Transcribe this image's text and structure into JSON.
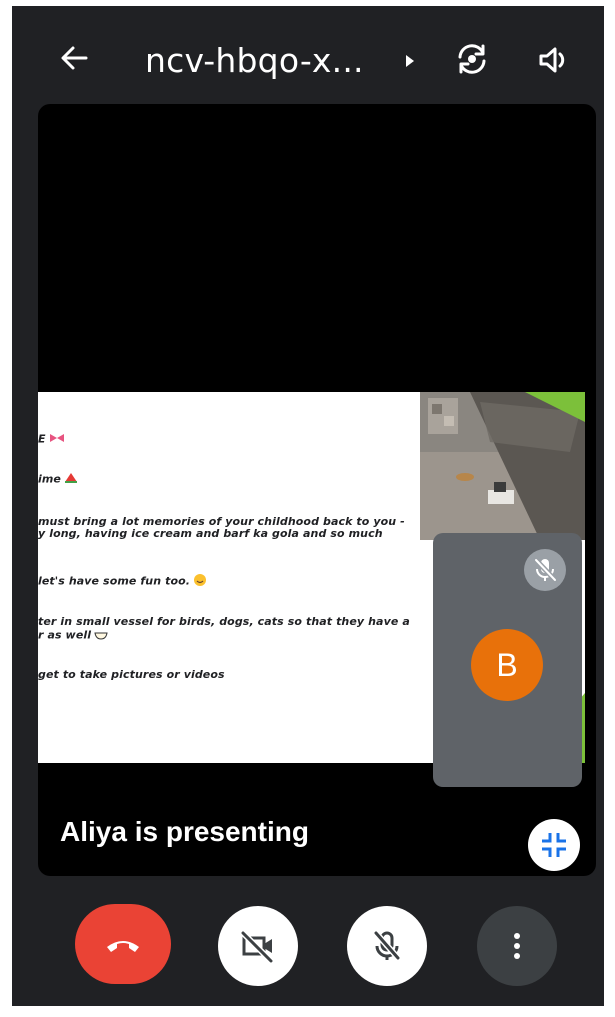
{
  "header": {
    "title": "ncv-hbqo-x...",
    "icons": [
      "back-arrow-icon",
      "expand-arrow-icon",
      "camera-switch-icon",
      "speaker-icon"
    ]
  },
  "slide": {
    "lines": [
      "E",
      "ime",
      "must bring a lot memories of your childhood back to you -",
      "y long, having ice cream and barf ka gola and so much",
      "let's have some fun too.",
      "ter in small vessel for birds, dogs, cats so that they have a",
      "r as well",
      "get to take pictures or videos"
    ]
  },
  "participant": {
    "initial": "B",
    "avatar_color": "#e8710a",
    "muted": true
  },
  "presenting_label": "Aliya is presenting",
  "controls": {
    "end_call_color": "#ea4335",
    "icons": [
      "end-call-icon",
      "camera-off-icon",
      "mic-off-icon",
      "more-vert-icon"
    ]
  },
  "colors": {
    "background": "#202124",
    "tile": "#5f6368",
    "accent_green": "#7cc03a"
  }
}
